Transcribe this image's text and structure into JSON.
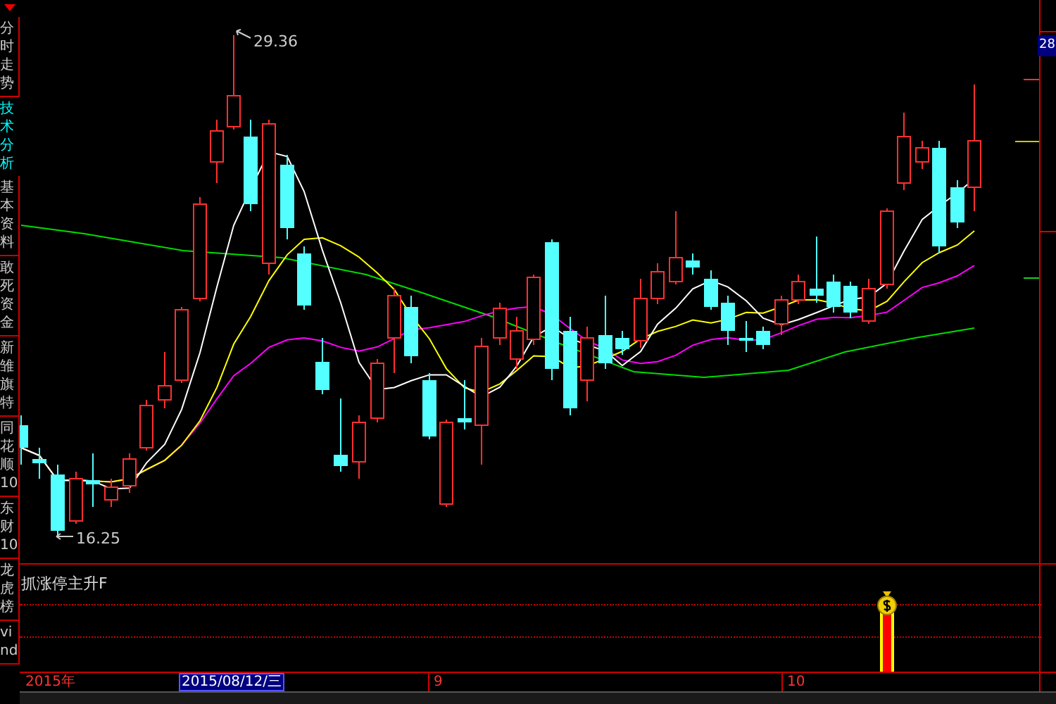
{
  "sidebar": {
    "items": [
      {
        "label": "分时走势",
        "selected": false
      },
      {
        "label": "技术分析",
        "selected": true
      },
      {
        "label": "基本资料",
        "selected": false
      },
      {
        "label": "敢死资金",
        "selected": false
      },
      {
        "label": "新雏旗特",
        "selected": false
      },
      {
        "label": "同花顺10",
        "selected": false
      },
      {
        "label": "东财10",
        "selected": false
      },
      {
        "label": "龙虎榜",
        "selected": false
      },
      {
        "label": "vind",
        "selected": false
      }
    ]
  },
  "chart": {
    "high_label": "29.36",
    "low_label": "16.25",
    "price_tag": "28"
  },
  "indicator": {
    "title": "抓涨停主升F"
  },
  "time_axis": {
    "year": "2015年",
    "cursor_date": "2015/08/12/三",
    "months": [
      "9",
      "10"
    ]
  }
}
